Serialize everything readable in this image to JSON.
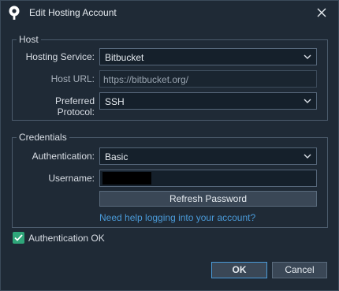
{
  "window": {
    "title": "Edit Hosting Account",
    "icon": "sourcetree-logo-icon",
    "close": "close-icon"
  },
  "host": {
    "legend": "Host",
    "service_label": "Hosting Service:",
    "service_value": "Bitbucket",
    "url_label": "Host URL:",
    "url_value": "https://bitbucket.org/",
    "protocol_label": "Preferred Protocol:",
    "protocol_value": "SSH"
  },
  "credentials": {
    "legend": "Credentials",
    "auth_label": "Authentication:",
    "auth_value": "Basic",
    "username_label": "Username:",
    "refresh_button": "Refresh Password",
    "help_link": "Need help logging into your account?"
  },
  "auth_ok": {
    "label": "Authentication OK",
    "checked": true,
    "color": "#2fa67a"
  },
  "buttons": {
    "ok": "OK",
    "cancel": "Cancel"
  },
  "colors": {
    "background": "#1f2a36",
    "link": "#4a9ad8",
    "accent_border": "#4a9ad8"
  }
}
